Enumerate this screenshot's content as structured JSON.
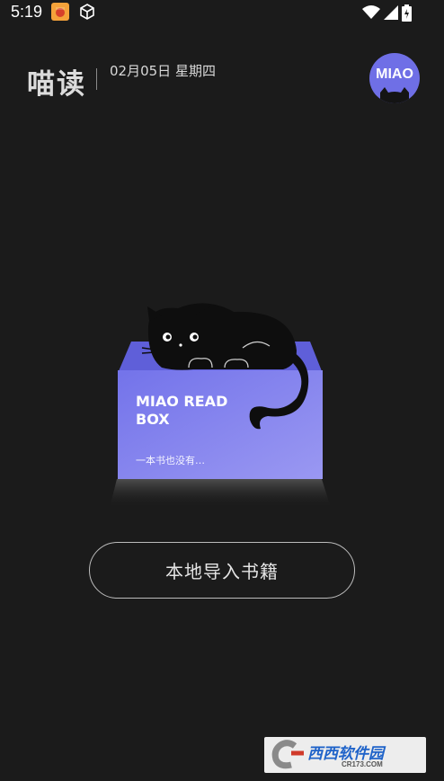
{
  "status_bar": {
    "time": "5:19",
    "icons": [
      "app-notification-icon",
      "cube-icon",
      "wifi-icon",
      "signal-icon",
      "battery-icon"
    ]
  },
  "header": {
    "logo": "喵读",
    "date": "02月05日 星期四",
    "avatar_text": "MIAO"
  },
  "empty_state": {
    "box_title": "MIAO READ BOX",
    "message": "一本书也没有…"
  },
  "actions": {
    "import_label": "本地导入书籍"
  },
  "watermark": {
    "brand": "西西软件园",
    "url": "CR173.COM"
  },
  "colors": {
    "background": "#1b1b1b",
    "box_purple": "#6f6fe6",
    "text": "#e4e4e4"
  }
}
